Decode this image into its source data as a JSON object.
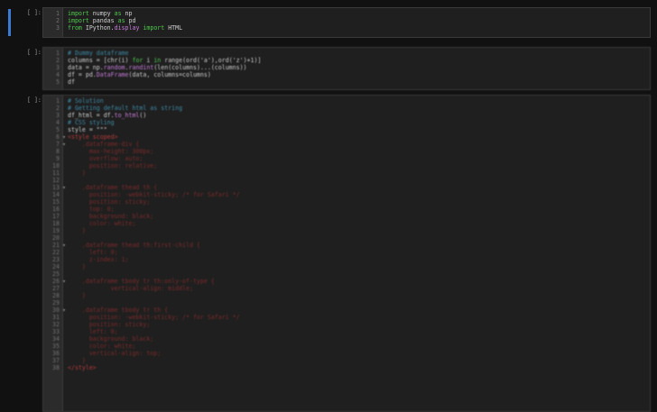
{
  "cells": [
    {
      "prompt": "[ ]:",
      "active": true,
      "lines": [
        {
          "n": "1",
          "t": [
            [
              "kw",
              "import"
            ],
            [
              "plain",
              " numpy "
            ],
            [
              "kw",
              "as"
            ],
            [
              "plain",
              " np"
            ]
          ]
        },
        {
          "n": "2",
          "t": [
            [
              "kw",
              "import"
            ],
            [
              "plain",
              " pandas "
            ],
            [
              "kw",
              "as"
            ],
            [
              "plain",
              " pd"
            ]
          ]
        },
        {
          "n": "3",
          "t": [
            [
              "kw",
              "from"
            ],
            [
              "plain",
              " IPython."
            ],
            [
              "fn",
              "display"
            ],
            [
              "plain",
              " "
            ],
            [
              "kw",
              "import"
            ],
            [
              "plain",
              " HTML"
            ]
          ]
        }
      ]
    },
    {
      "prompt": "[ ]:",
      "active": false,
      "lines": [
        {
          "n": "1",
          "t": [
            [
              "cmt",
              "# Dummy dataframe"
            ]
          ]
        },
        {
          "n": "2",
          "t": [
            [
              "plain",
              "columns = [chr(i) "
            ],
            [
              "kw",
              "for"
            ],
            [
              "plain",
              " i "
            ],
            [
              "kw",
              "in"
            ],
            [
              "plain",
              " range(ord('a'),ord('z')+1)]"
            ]
          ]
        },
        {
          "n": "3",
          "t": [
            [
              "plain",
              "data = np."
            ],
            [
              "fn",
              "random"
            ],
            [
              "plain",
              "."
            ],
            [
              "fn",
              "randint"
            ],
            [
              "plain",
              "(len(columns)...(columns))"
            ]
          ]
        },
        {
          "n": "4",
          "t": [
            [
              "plain",
              "df = pd."
            ],
            [
              "fn",
              "DataFrame"
            ],
            [
              "plain",
              "(data, columns=columns)"
            ]
          ]
        },
        {
          "n": "5",
          "t": [
            [
              "plain",
              "df"
            ]
          ]
        }
      ]
    },
    {
      "prompt": "[ ]:",
      "active": false,
      "lines": [
        {
          "n": "1",
          "t": [
            [
              "cmt",
              "# Solution"
            ]
          ]
        },
        {
          "n": "2",
          "t": [
            [
              "cmt",
              "# Getting default html as string"
            ]
          ]
        },
        {
          "n": "3",
          "t": [
            [
              "plain",
              "df_html = df."
            ],
            [
              "fn",
              "to_html"
            ],
            [
              "plain",
              "()"
            ]
          ]
        },
        {
          "n": "4",
          "t": [
            [
              "cmt",
              "# CSS styling"
            ]
          ]
        },
        {
          "n": "5",
          "t": [
            [
              "plain",
              "style = \"\"\""
            ]
          ]
        },
        {
          "n": "6",
          "f": true,
          "t": [
            [
              "str",
              "<style scoped>"
            ]
          ]
        },
        {
          "n": "7",
          "f": true,
          "t": [
            [
              "css",
              "    .dataframe-div {"
            ]
          ]
        },
        {
          "n": "8",
          "t": [
            [
              "css",
              "      max-height: 300px;"
            ]
          ]
        },
        {
          "n": "9",
          "t": [
            [
              "css",
              "      overflow: auto;"
            ]
          ]
        },
        {
          "n": "10",
          "t": [
            [
              "css",
              "      position: relative;"
            ]
          ]
        },
        {
          "n": "11",
          "t": [
            [
              "css",
              "    }"
            ]
          ]
        },
        {
          "n": "12",
          "t": [
            [
              "plain",
              ""
            ]
          ]
        },
        {
          "n": "13",
          "f": true,
          "t": [
            [
              "css",
              "    .dataframe thead th {"
            ]
          ]
        },
        {
          "n": "14",
          "t": [
            [
              "css",
              "      position: -webkit-sticky; /* for Safari */"
            ]
          ]
        },
        {
          "n": "15",
          "t": [
            [
              "css",
              "      position: sticky;"
            ]
          ]
        },
        {
          "n": "16",
          "t": [
            [
              "css",
              "      top: 0;"
            ]
          ]
        },
        {
          "n": "17",
          "t": [
            [
              "css",
              "      background: black;"
            ]
          ]
        },
        {
          "n": "18",
          "t": [
            [
              "css",
              "      color: white;"
            ]
          ]
        },
        {
          "n": "19",
          "t": [
            [
              "css",
              "    }"
            ]
          ]
        },
        {
          "n": "20",
          "t": [
            [
              "plain",
              ""
            ]
          ]
        },
        {
          "n": "21",
          "f": true,
          "t": [
            [
              "css",
              "    .dataframe thead th:first-child {"
            ]
          ]
        },
        {
          "n": "22",
          "t": [
            [
              "css",
              "      left: 0;"
            ]
          ]
        },
        {
          "n": "23",
          "t": [
            [
              "css",
              "      z-index: 1;"
            ]
          ]
        },
        {
          "n": "24",
          "t": [
            [
              "css",
              "    }"
            ]
          ]
        },
        {
          "n": "25",
          "t": [
            [
              "plain",
              ""
            ]
          ]
        },
        {
          "n": "26",
          "f": true,
          "t": [
            [
              "css",
              "    .dataframe tbody tr th:only-of-type {"
            ]
          ]
        },
        {
          "n": "27",
          "t": [
            [
              "css",
              "            vertical-align: middle;"
            ]
          ]
        },
        {
          "n": "28",
          "t": [
            [
              "css",
              "    }"
            ]
          ]
        },
        {
          "n": "29",
          "t": [
            [
              "plain",
              ""
            ]
          ]
        },
        {
          "n": "30",
          "f": true,
          "t": [
            [
              "css",
              "    .dataframe tbody tr th {"
            ]
          ]
        },
        {
          "n": "31",
          "t": [
            [
              "css",
              "      position: -webkit-sticky; /* for Safari */"
            ]
          ]
        },
        {
          "n": "32",
          "t": [
            [
              "css",
              "      position: sticky;"
            ]
          ]
        },
        {
          "n": "33",
          "t": [
            [
              "css",
              "      left: 0;"
            ]
          ]
        },
        {
          "n": "34",
          "t": [
            [
              "css",
              "      background: black;"
            ]
          ]
        },
        {
          "n": "35",
          "t": [
            [
              "css",
              "      color: white;"
            ]
          ]
        },
        {
          "n": "36",
          "t": [
            [
              "css",
              "      vertical-align: top;"
            ]
          ]
        },
        {
          "n": "37",
          "t": [
            [
              "css",
              "    }"
            ]
          ]
        },
        {
          "n": "38",
          "t": [
            [
              "str",
              "</style>"
            ]
          ]
        }
      ]
    }
  ]
}
